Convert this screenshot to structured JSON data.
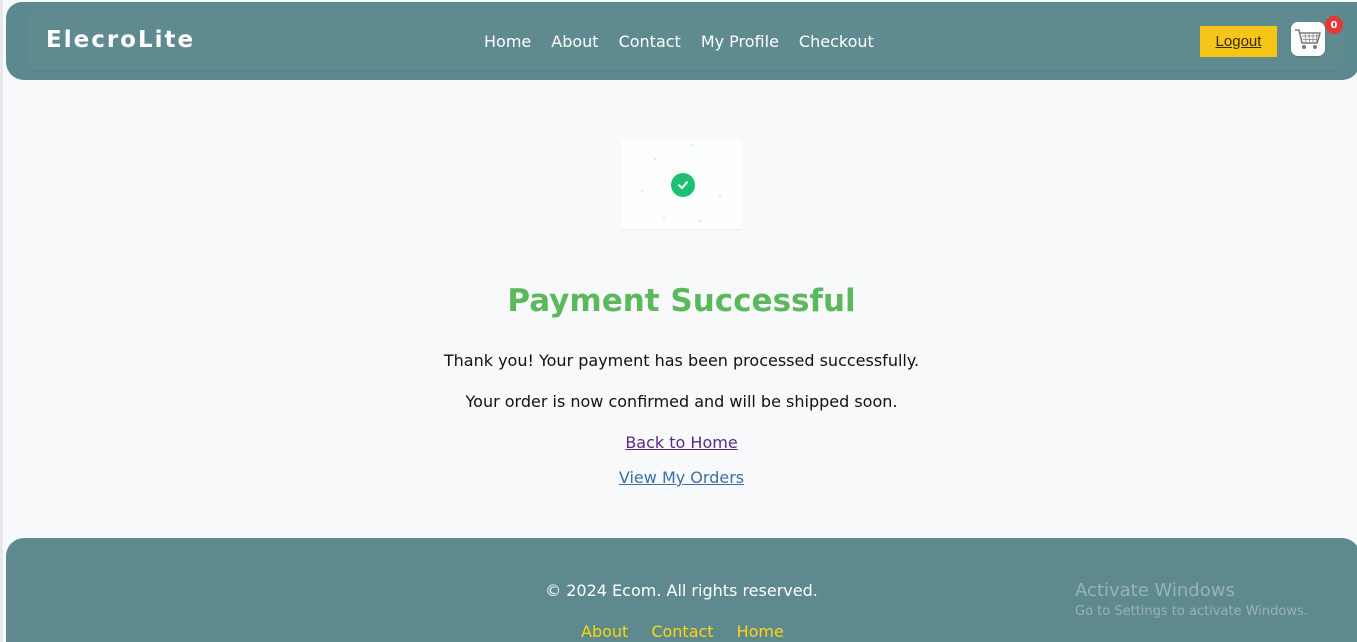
{
  "header": {
    "brand": "ElecroLite",
    "nav": [
      "Home",
      "About",
      "Contact",
      "My Profile",
      "Checkout"
    ],
    "logout_label": "Logout",
    "cart_count": "0",
    "cart_icon": "shopping-cart-icon"
  },
  "main": {
    "status_icon": "check-circle-icon",
    "title": "Payment Successful",
    "message_1": "Thank you! Your payment has been processed successfully.",
    "message_2": "Your order is now confirmed and will be shipped soon.",
    "back_home_label": "Back to Home",
    "view_orders_label": "View My Orders"
  },
  "footer": {
    "copyright": "© 2024 Ecom. All rights reserved.",
    "links": [
      "About",
      "Contact",
      "Home"
    ]
  },
  "watermark": {
    "title": "Activate Windows",
    "subtitle": "Go to Settings to activate Windows."
  },
  "colors": {
    "header_bg": "#5a8a90",
    "accent_yellow": "#f5c518",
    "success_green": "#5cb85c",
    "badge_red": "#e53935",
    "footer_link": "#ffd60a"
  }
}
